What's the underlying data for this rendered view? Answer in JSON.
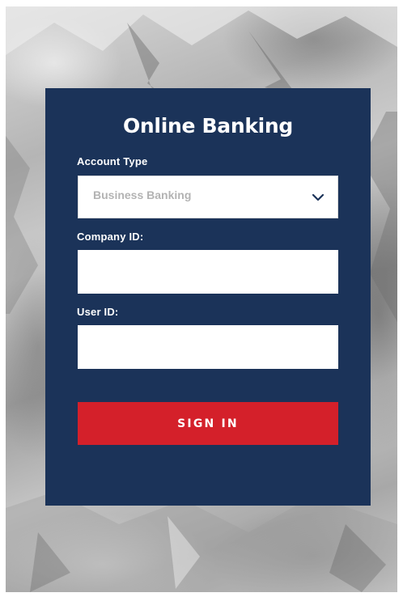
{
  "login": {
    "title": "Online Banking",
    "account_type": {
      "label": "Account Type",
      "selected": "Business Banking"
    },
    "company_id": {
      "label": "Company ID:",
      "value": ""
    },
    "user_id": {
      "label": "User ID:",
      "value": ""
    },
    "sign_in_label": "SIGN IN"
  },
  "colors": {
    "card_background": "#1b3359",
    "button_background": "#d4202a",
    "select_text": "#b3b3b3"
  },
  "icons": {
    "select_arrow": "chevron-down-icon",
    "background": "mountain-photo"
  }
}
